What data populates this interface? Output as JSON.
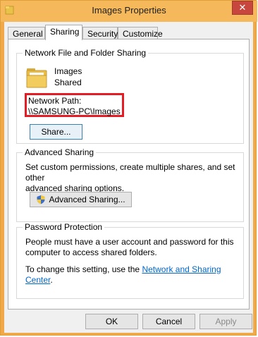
{
  "window": {
    "title": "Images Properties",
    "close_glyph": "✕"
  },
  "tabs": [
    "General",
    "Sharing",
    "Security",
    "Customize"
  ],
  "network": {
    "group_title": "Network File and Folder Sharing",
    "folder_name": "Images",
    "folder_state": "Shared",
    "path_label": "Network Path:",
    "path_value": "\\\\SAMSUNG-PC\\Images",
    "share_button": "Share..."
  },
  "advanced": {
    "group_title": "Advanced Sharing",
    "description_line1": "Set custom permissions, create multiple shares, and set other",
    "description_line2": "advanced sharing options.",
    "button": "Advanced Sharing..."
  },
  "password": {
    "group_title": "Password Protection",
    "line1": "People must have a user account and password for this",
    "line2": "computer to access shared folders.",
    "change_prefix": "To change this setting, use the ",
    "link_text": "Network and Sharing Center",
    "change_suffix": "."
  },
  "footer": {
    "ok": "OK",
    "cancel": "Cancel",
    "apply": "Apply"
  },
  "colors": {
    "frame": "#f5b85a",
    "close": "#c7463d",
    "link": "#0066cc",
    "highlight": "#e51c23"
  },
  "icons": {
    "app": "folder-icon",
    "folder": "folder-icon",
    "uac": "shield-icon"
  }
}
